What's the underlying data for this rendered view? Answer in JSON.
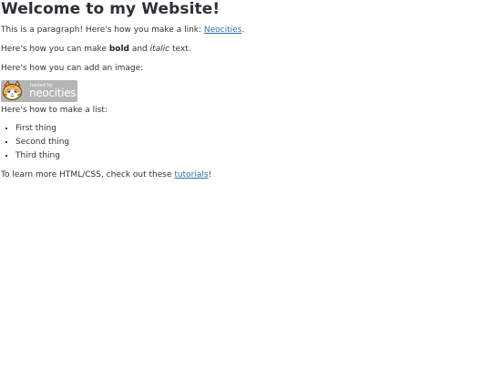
{
  "heading": "Welcome to my Website!",
  "paragraph1": {
    "before": "This is a paragraph! Here's how you make a link: ",
    "link_text": "Neocities",
    "after": "."
  },
  "paragraph2": {
    "before": "Here's how you can make ",
    "bold": "bold",
    "middle": " and ",
    "italic": "italic",
    "after": " text."
  },
  "paragraph3": "Here's how you can add an image:",
  "badge": {
    "top_text": "hosted by",
    "main_text": "neocities",
    "icon": "neocities-cat-icon"
  },
  "paragraph4": "Here's how to make a list:",
  "list_items": [
    "First thing",
    "Second thing",
    "Third thing"
  ],
  "paragraph5": {
    "before": "To learn more HTML/CSS, check out these ",
    "link_text": "tutorials",
    "after": "!"
  },
  "colors": {
    "link": "#2f6fa3",
    "text": "#333333",
    "badge_bg": "#b5b5b5"
  }
}
